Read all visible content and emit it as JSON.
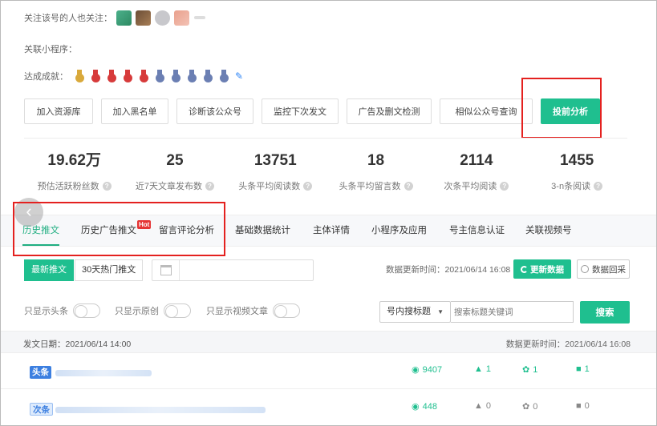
{
  "followers": {
    "label": "关注该号的人也关注："
  },
  "mini_program": {
    "label": "关联小程序："
  },
  "achievements": {
    "label": "达成成就：",
    "medal_colors": [
      "#d9a93b",
      "#d73b3b",
      "#d73b3b",
      "#d73b3b",
      "#d73b3b",
      "#6b7fb3",
      "#6b7fb3",
      "#6b7fb3",
      "#6b7fb3",
      "#6b7fb3"
    ],
    "edit_icon": "pencil-icon"
  },
  "actions": [
    {
      "label": "加入资源库",
      "primary": false
    },
    {
      "label": "加入黑名单",
      "primary": false
    },
    {
      "label": "诊断该公众号",
      "primary": false
    },
    {
      "label": "监控下次发文",
      "primary": false
    },
    {
      "label": "广告及删文检测",
      "primary": false
    },
    {
      "label": "相似公众号查询",
      "primary": false
    },
    {
      "label": "投前分析",
      "primary": true
    }
  ],
  "stats": [
    {
      "value": "19.62万",
      "label": "预估活跃粉丝数"
    },
    {
      "value": "25",
      "label": "近7天文章发布数"
    },
    {
      "value": "13751",
      "label": "头条平均阅读数"
    },
    {
      "value": "18",
      "label": "头条平均留言数"
    },
    {
      "value": "2114",
      "label": "次条平均阅读"
    },
    {
      "value": "1455",
      "label": "3-n条阅读"
    }
  ],
  "help_glyph": "?",
  "back_glyph": "‹",
  "tabs": [
    {
      "label": "历史推文",
      "active": true
    },
    {
      "label": "历史广告推文",
      "active": false
    },
    {
      "label": "留言评论分析",
      "active": false
    },
    {
      "label": "基础数据统计",
      "active": false
    },
    {
      "label": "主体详情",
      "active": false
    },
    {
      "label": "小程序及应用",
      "active": false
    },
    {
      "label": "号主信息认证",
      "active": false
    },
    {
      "label": "关联视频号",
      "active": false
    }
  ],
  "hot_badge": "Hot",
  "subtabs": [
    {
      "label": "最新推文",
      "active": true
    },
    {
      "label": "30天热门推文",
      "active": false
    }
  ],
  "data_update": {
    "text": "数据更新时间：2021/06/14 16:08",
    "refresh_label": "更新数据",
    "backtrack_label": "数据回采"
  },
  "filters": [
    {
      "label": "只显示头条"
    },
    {
      "label": "只显示原创"
    },
    {
      "label": "只显示视频文章"
    }
  ],
  "search": {
    "scope": "号内搜标题",
    "placeholder": "搜索标题关键词",
    "button": "搜索"
  },
  "date_bar": {
    "left": "发文日期：2021/06/14 14:00",
    "right": "数据更新时间：2021/06/14 16:08"
  },
  "articles": [
    {
      "position": "头条",
      "reads": "9407",
      "likes": "1",
      "looks": "1",
      "comments": "1",
      "active": true
    },
    {
      "position": "次条",
      "reads": "448",
      "likes": "0",
      "looks": "0",
      "comments": "0",
      "active": false
    }
  ],
  "colors": {
    "accent": "#1fbf8f",
    "highlight": "#e4211f",
    "active_tab": "#1fae81",
    "head_badge": "#3c7fe0"
  }
}
